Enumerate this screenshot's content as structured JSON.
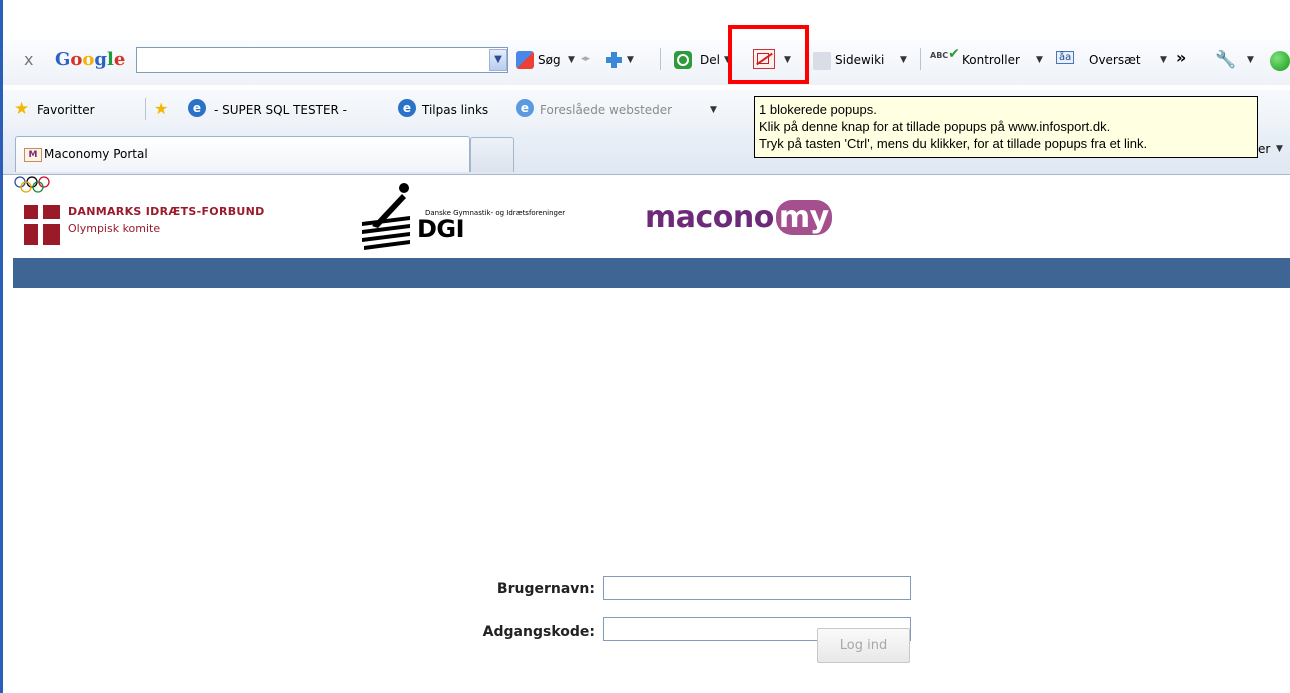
{
  "google_toolbar": {
    "close": "x",
    "logo": "Google",
    "search_value": "",
    "search_label": "Søg",
    "share_label": "Del",
    "sidewiki_label": "Sidewiki",
    "spellcheck_label": "Kontroller",
    "translate_label": "Oversæt",
    "more_label": "»"
  },
  "favorites_bar": {
    "favorites_label": "Favoritter",
    "link1": "- SUPER SQL TESTER -",
    "link2": "Tilpas links",
    "link3": "Foreslåede websteder"
  },
  "tooltip": {
    "line1": "1 blokerede popups.",
    "line2": "Klik på denne knap for at tillade popups på www.infosport.dk.",
    "line3": "Tryk på tasten 'Ctrl', mens du klikker, for at tillade popups fra et link."
  },
  "tabs": [
    {
      "title": "Maconomy Portal"
    }
  ],
  "tab_overflow_label": "er",
  "header": {
    "dif_name": "DANMARKS IDRÆTS-FORBUND",
    "dif_sub": "Olympisk komite",
    "dgi_small": "Danske Gymnastik- og Idrætsforeninger",
    "dgi_big": "DGI",
    "maconomy_main": "macono",
    "maconomy_end": "my"
  },
  "login": {
    "username_label": "Brugernavn:",
    "username_value": "",
    "password_label": "Adgangskode:",
    "password_value": "",
    "submit_label": "Log ind"
  },
  "colors": {
    "blue_band": "#3f6595",
    "highlight": "#ff0000",
    "dif_red": "#9a1a2a",
    "maconomy_purple": "#6d2a79"
  }
}
